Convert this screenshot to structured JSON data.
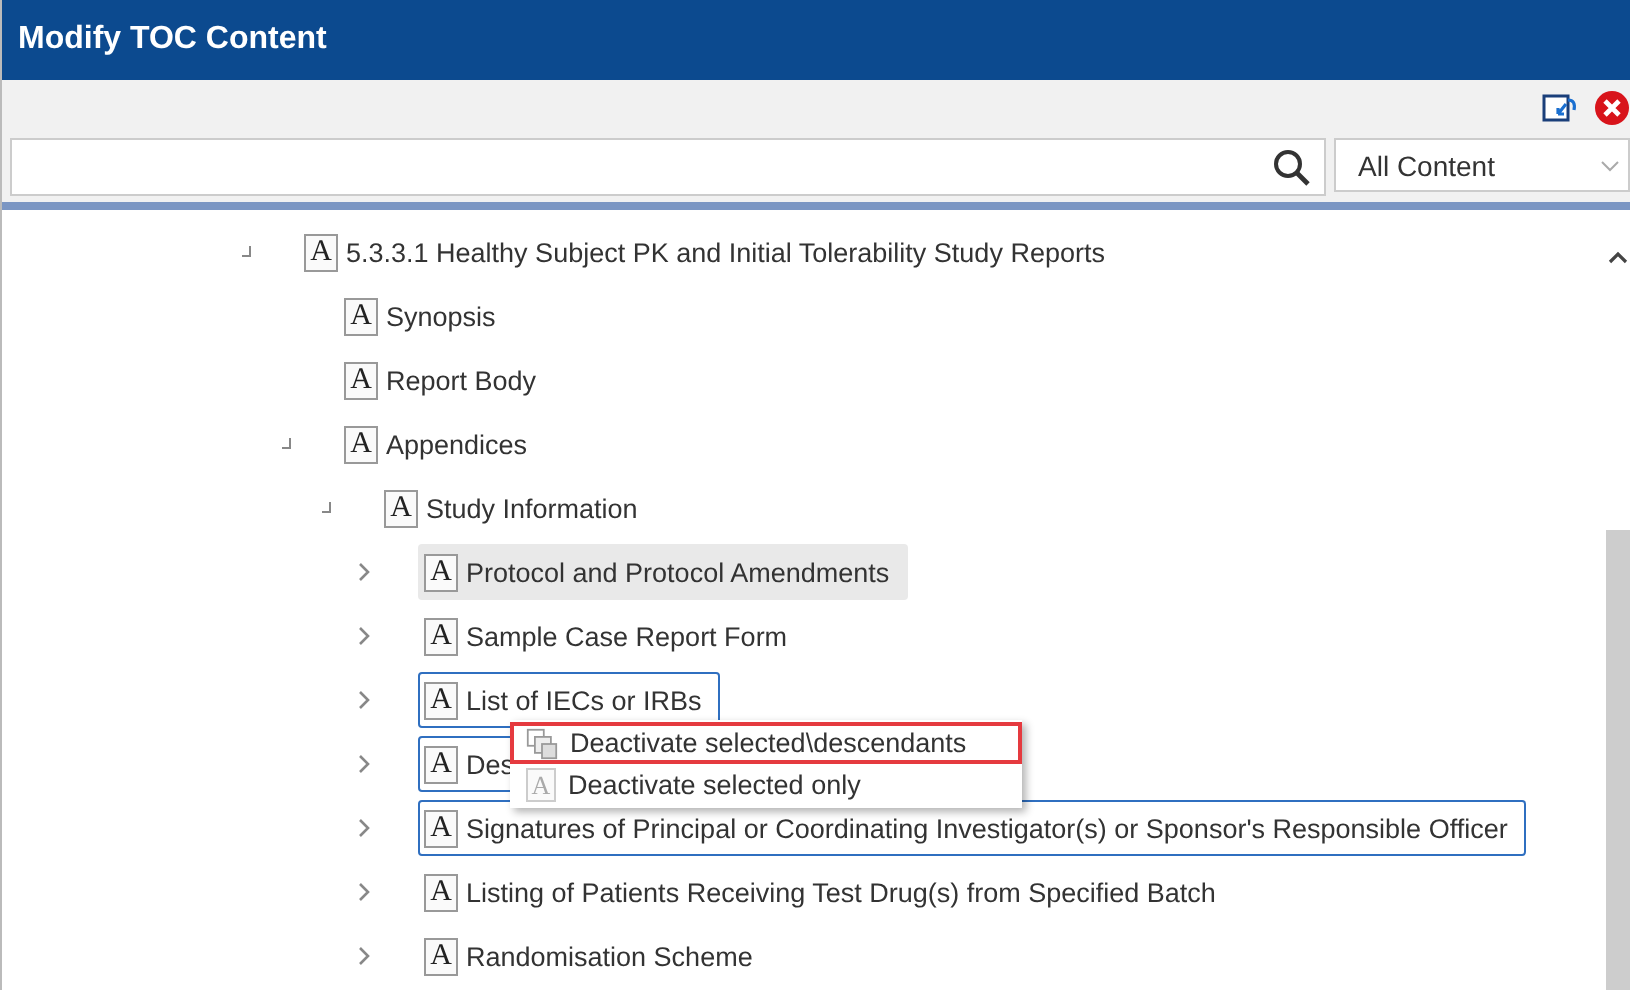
{
  "window": {
    "title": "Modify TOC Content"
  },
  "search": {
    "filter": "All Content"
  },
  "tree": {
    "nodes": [
      {
        "label": "5.3.3.1 Healthy Subject PK and Initial Tolerability Study Reports",
        "icon": "A",
        "expanded": true,
        "focused": false,
        "selected": false,
        "children": [
          {
            "label": "Synopsis",
            "icon": "A",
            "focused": false,
            "selected": false
          },
          {
            "label": "Report Body",
            "icon": "A",
            "focused": false,
            "selected": false
          },
          {
            "label": "Appendices",
            "icon": "A",
            "expanded": true,
            "focused": false,
            "selected": false,
            "children": [
              {
                "label": "Study Information",
                "icon": "A",
                "expanded": true,
                "focused": false,
                "selected": false,
                "children": [
                  {
                    "label": "Protocol and Protocol Amendments",
                    "icon": "A",
                    "expanded": false,
                    "focused": true,
                    "selected": false
                  },
                  {
                    "label": "Sample Case Report Form",
                    "icon": "A",
                    "expanded": false,
                    "focused": false,
                    "selected": false
                  },
                  {
                    "label": "List of IECs or IRBs",
                    "icon": "A",
                    "expanded": false,
                    "focused": false,
                    "selected": true
                  },
                  {
                    "label": "Des",
                    "icon": "A",
                    "expanded": false,
                    "focused": false,
                    "selected": true
                  },
                  {
                    "label": "Signatures of Principal or Coordinating Investigator(s) or Sponsor's Responsible Officer",
                    "icon": "A",
                    "expanded": false,
                    "focused": false,
                    "selected": true
                  },
                  {
                    "label": "Listing of Patients Receiving Test Drug(s) from Specified Batch",
                    "icon": "A",
                    "expanded": false,
                    "focused": false,
                    "selected": false
                  },
                  {
                    "label": "Randomisation Scheme",
                    "icon": "A",
                    "expanded": false,
                    "focused": false,
                    "selected": false
                  }
                ]
              }
            ]
          }
        ]
      }
    ]
  },
  "context_menu": {
    "items": [
      {
        "label": "Deactivate selected\\descendants",
        "kind": "descendants",
        "selected": true
      },
      {
        "label": "Deactivate selected only",
        "kind": "single",
        "icon": "A",
        "selected": false
      }
    ]
  }
}
